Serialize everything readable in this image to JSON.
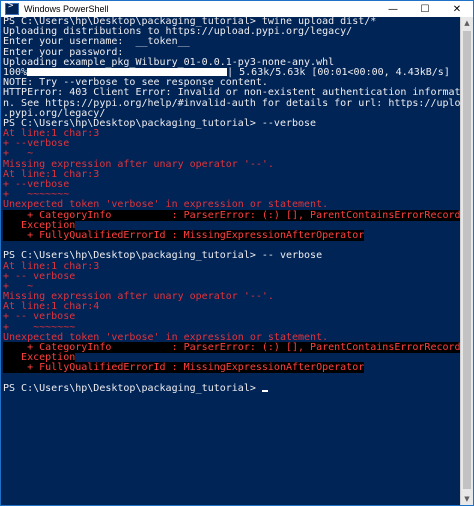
{
  "window": {
    "title": "Windows PowerShell",
    "minimize_glyph": "—",
    "maximize_glyph": "☐",
    "close_glyph": "✕"
  },
  "colors": {
    "console_bg": "#012456",
    "text": "#eeedf0",
    "error": "#e0333b"
  },
  "console": {
    "lines": [
      {
        "text": "PS C:\\Users\\hp\\Desktop\\packaging_tutorial> twine upload dist/*",
        "style": "normal"
      },
      {
        "text": "Uploading distributions to https://upload.pypi.org/legacy/",
        "style": "normal"
      },
      {
        "text": "Enter your username:  __token__",
        "style": "normal"
      },
      {
        "text": "Enter your password:",
        "style": "normal"
      },
      {
        "text": "Uploading example_pkg_Wilbury_01-0.0.1-py3-none-any.whl",
        "style": "normal"
      },
      {
        "text": "100%",
        "suffix": "| 5.63k/5.63k [00:01<00:00, 4.43kB/s]",
        "style": "progress"
      },
      {
        "text": "NOTE: Try --verbose to see response content.",
        "style": "normal"
      },
      {
        "text": "HTTPError: 403 Client Error: Invalid or non-existent authentication informatio",
        "style": "normal"
      },
      {
        "text": "n. See https://pypi.org/help/#invalid-auth for details for url: https://upload",
        "style": "normal"
      },
      {
        "text": ".pypi.org/legacy/",
        "style": "normal"
      },
      {
        "text": "PS C:\\Users\\hp\\Desktop\\packaging_tutorial> --verbose",
        "style": "normal"
      },
      {
        "text": "At line:1 char:3",
        "style": "err"
      },
      {
        "text": "+ --verbose",
        "style": "err"
      },
      {
        "text": "+   ~",
        "style": "err"
      },
      {
        "text": "Missing expression after unary operator '--'.",
        "style": "err"
      },
      {
        "text": "At line:1 char:3",
        "style": "err"
      },
      {
        "text": "+ --verbose",
        "style": "err"
      },
      {
        "text": "+   ~~~~~~~",
        "style": "err"
      },
      {
        "text": "Unexpected token 'verbose' in expression or statement.",
        "style": "err"
      },
      {
        "text": "    + CategoryInfo          : ParserError: (:) [], ParentContainsErrorRecord",
        "style": "errblk"
      },
      {
        "text": "   Exception",
        "style": "errblk"
      },
      {
        "text": "    + FullyQualifiedErrorId : MissingExpressionAfterOperator",
        "style": "errblk"
      },
      {
        "text": "",
        "style": "normal"
      },
      {
        "text": "PS C:\\Users\\hp\\Desktop\\packaging_tutorial> -- verbose",
        "style": "normal"
      },
      {
        "text": "At line:1 char:3",
        "style": "err"
      },
      {
        "text": "+ -- verbose",
        "style": "err"
      },
      {
        "text": "+   ~",
        "style": "err"
      },
      {
        "text": "Missing expression after unary operator '--'.",
        "style": "err"
      },
      {
        "text": "At line:1 char:4",
        "style": "err"
      },
      {
        "text": "+ -- verbose",
        "style": "err"
      },
      {
        "text": "+    ~~~~~~~",
        "style": "err"
      },
      {
        "text": "Unexpected token 'verbose' in expression or statement.",
        "style": "err"
      },
      {
        "text": "    + CategoryInfo          : ParserError: (:) [], ParentContainsErrorRecord",
        "style": "errblk"
      },
      {
        "text": "   Exception",
        "style": "errblk"
      },
      {
        "text": "    + FullyQualifiedErrorId : MissingExpressionAfterOperator",
        "style": "errblk"
      },
      {
        "text": "",
        "style": "normal"
      },
      {
        "text": "PS C:\\Users\\hp\\Desktop\\packaging_tutorial> ",
        "style": "prompt"
      }
    ]
  }
}
